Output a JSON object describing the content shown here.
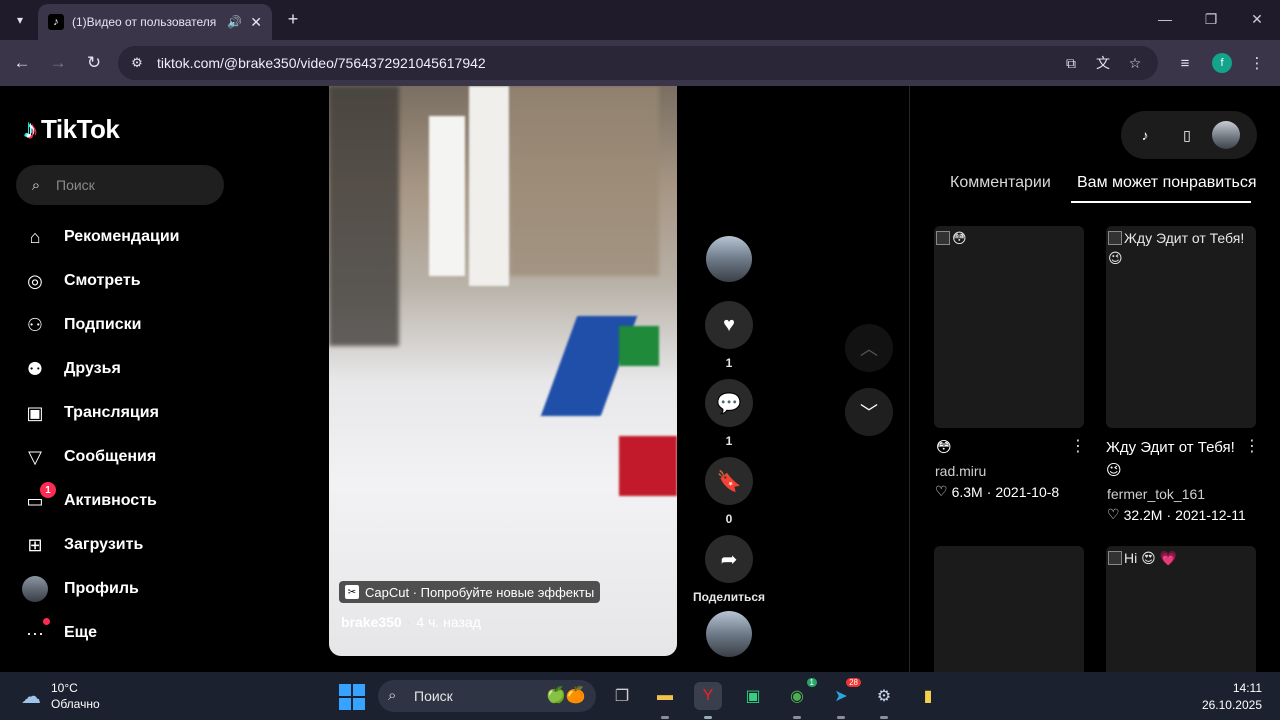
{
  "browser": {
    "tab_title": "(1)Видео от пользователя",
    "url": "tiktok.com/@brake350/video/7564372921045617942",
    "profile_initial": "f"
  },
  "sidebar": {
    "logo": "TikTok",
    "search_placeholder": "Поиск",
    "items": [
      {
        "label": "Рекомендации",
        "icon": "home-icon"
      },
      {
        "label": "Смотреть",
        "icon": "compass-icon"
      },
      {
        "label": "Подписки",
        "icon": "following-icon"
      },
      {
        "label": "Друзья",
        "icon": "friends-icon"
      },
      {
        "label": "Трансляция",
        "icon": "live-icon"
      },
      {
        "label": "Сообщения",
        "icon": "messages-icon"
      },
      {
        "label": "Активность",
        "icon": "activity-icon",
        "badge": "1"
      },
      {
        "label": "Загрузить",
        "icon": "upload-icon"
      },
      {
        "label": "Профиль",
        "icon": "avatar"
      },
      {
        "label": "Еще",
        "icon": "more-icon"
      }
    ]
  },
  "video": {
    "capcut_label": "CapCut · Попробуйте новые эффекты",
    "author": "brake350",
    "time_ago": "4 ч. назад"
  },
  "actions": {
    "likes": "1",
    "comments": "1",
    "saves": "0",
    "share_label": "Поделиться"
  },
  "right_panel": {
    "tabs": [
      "Комментарии",
      "Вам может понравиться"
    ],
    "cards": [
      {
        "thumb_title": "😳",
        "title": "😳",
        "author": "rad.miru",
        "likes": "6.3M",
        "date": "2021-10-8"
      },
      {
        "thumb_title": "Жду Эдит от Тебя! 😉",
        "title": "Жду Эдит от Тебя! 😉",
        "author": "fermer_tok_161",
        "likes": "32.2M",
        "date": "2021-12-11"
      },
      {
        "thumb_title": ""
      },
      {
        "thumb_title": "Hi 😍 💗"
      }
    ]
  },
  "taskbar": {
    "temp": "10°C",
    "condition": "Облачно",
    "search_label": "Поиск",
    "time": "14:11",
    "date": "26.10.2025",
    "yandex_badge": "",
    "chrome_badge": "1",
    "telegram_badge": "28"
  }
}
